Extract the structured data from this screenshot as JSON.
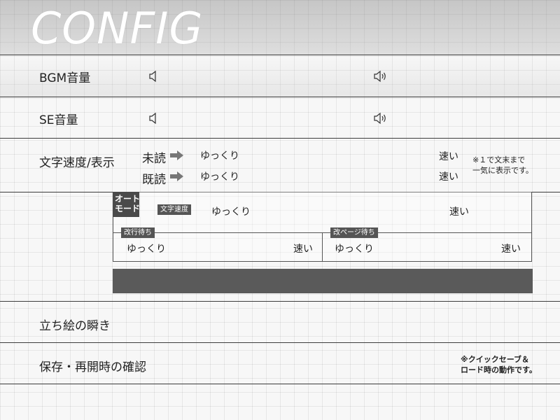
{
  "header": {
    "title": "CONFIG"
  },
  "bgm": {
    "label": "BGM音量"
  },
  "se": {
    "label": "SE音量"
  },
  "text_speed": {
    "label": "文字速度/表示",
    "unread_label": "未読",
    "read_label": "既読",
    "slow": "ゆっくり",
    "fast": "速い",
    "note": "※１で文末まで\n一気に表示です。"
  },
  "auto_mode": {
    "tag": "オート\nモード",
    "text_speed_tag": "文字速度",
    "slow": "ゆっくり",
    "fast": "速い",
    "line_wait": {
      "tag": "改行待ち",
      "slow": "ゆっくり",
      "fast": "速い"
    },
    "page_wait": {
      "tag": "改ページ待ち",
      "slow": "ゆっくり",
      "fast": "速い"
    }
  },
  "blink": {
    "label": "立ち絵の瞬き"
  },
  "confirm": {
    "label": "保存・再開時の確認",
    "note": "※クイックセーブ＆\nロード時の動作です。"
  },
  "icons": {
    "volume_min": "speaker-mute-icon",
    "volume_max": "speaker-loud-icon",
    "arrow": "arrow-right-icon"
  },
  "colors": {
    "line": "#3c3c3c",
    "tag_bg": "#555555",
    "dark_bar": "#5a5a5a"
  }
}
